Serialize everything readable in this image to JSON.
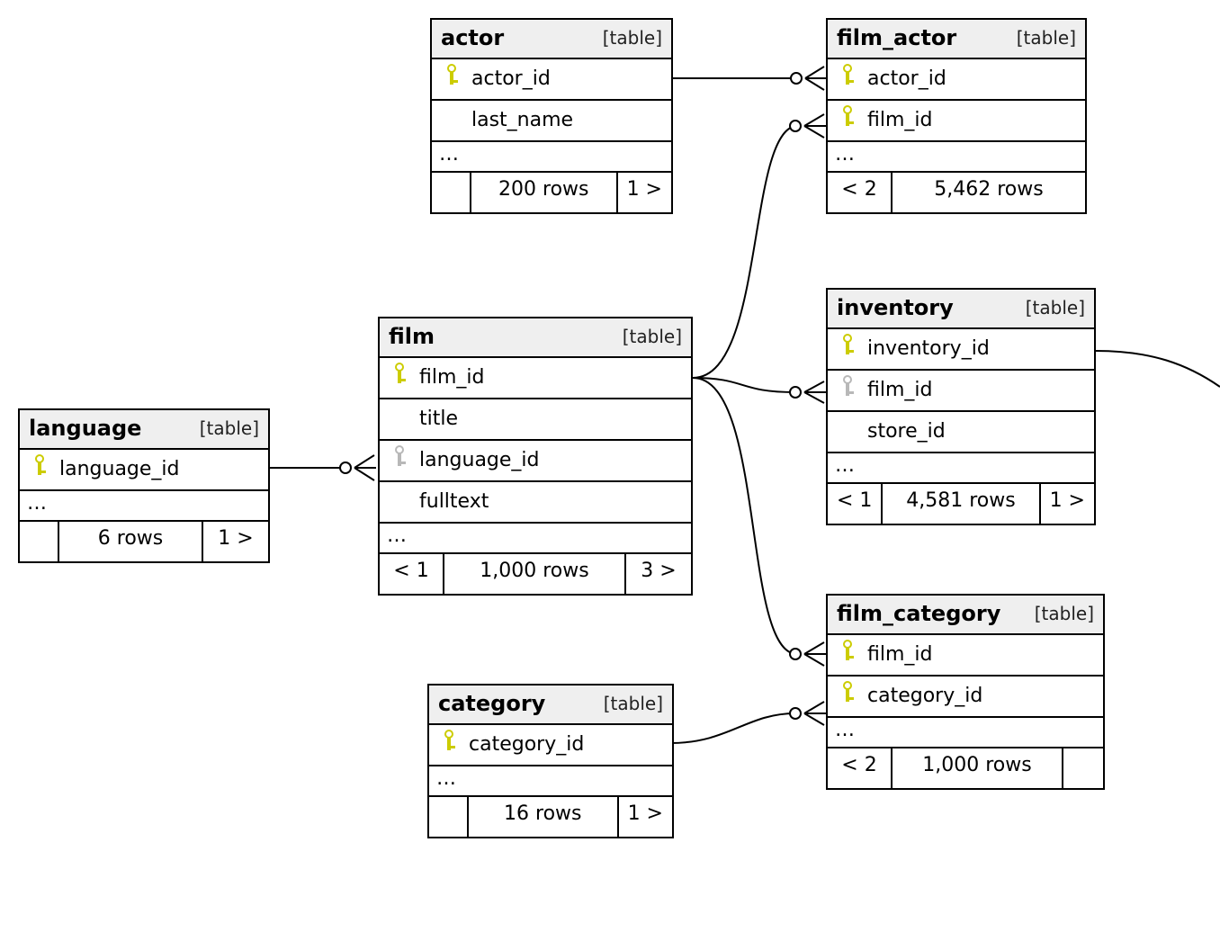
{
  "type_label": "[table]",
  "ellipsis": "…",
  "tables": {
    "actor": {
      "name": "actor",
      "cols": {
        "actor_id": "actor_id",
        "last_name": "last_name"
      },
      "footer": {
        "rows": "200 rows",
        "right": "1 >"
      }
    },
    "film_actor": {
      "name": "film_actor",
      "cols": {
        "actor_id": "actor_id",
        "film_id": "film_id"
      },
      "footer": {
        "left": "< 2",
        "rows": "5,462 rows"
      }
    },
    "inventory": {
      "name": "inventory",
      "cols": {
        "inventory_id": "inventory_id",
        "film_id": "film_id",
        "store_id": "store_id"
      },
      "footer": {
        "left": "< 1",
        "rows": "4,581 rows",
        "right": "1 >"
      }
    },
    "film_category": {
      "name": "film_category",
      "cols": {
        "film_id": "film_id",
        "category_id": "category_id"
      },
      "footer": {
        "left": "< 2",
        "rows": "1,000 rows"
      }
    },
    "category": {
      "name": "category",
      "cols": {
        "category_id": "category_id"
      },
      "footer": {
        "rows": "16 rows",
        "right": "1 >"
      }
    },
    "film": {
      "name": "film",
      "cols": {
        "film_id": "film_id",
        "title": "title",
        "language_id": "language_id",
        "fulltext": "fulltext"
      },
      "footer": {
        "left": "< 1",
        "rows": "1,000 rows",
        "right": "3 >"
      }
    },
    "language": {
      "name": "language",
      "cols": {
        "language_id": "language_id"
      },
      "footer": {
        "rows": "6 rows",
        "right": "1 >"
      }
    }
  },
  "relationships": [
    {
      "from": "actor.actor_id",
      "to": "film_actor.actor_id",
      "cardinality": "one-to-many"
    },
    {
      "from": "film.film_id",
      "to": "film_actor.film_id",
      "cardinality": "one-to-many"
    },
    {
      "from": "film.film_id",
      "to": "inventory.film_id",
      "cardinality": "one-to-many"
    },
    {
      "from": "film.film_id",
      "to": "film_category.film_id",
      "cardinality": "one-to-many"
    },
    {
      "from": "language.language_id",
      "to": "film.language_id",
      "cardinality": "one-to-many"
    },
    {
      "from": "category.category_id",
      "to": "film_category.category_id",
      "cardinality": "one-to-many"
    }
  ]
}
